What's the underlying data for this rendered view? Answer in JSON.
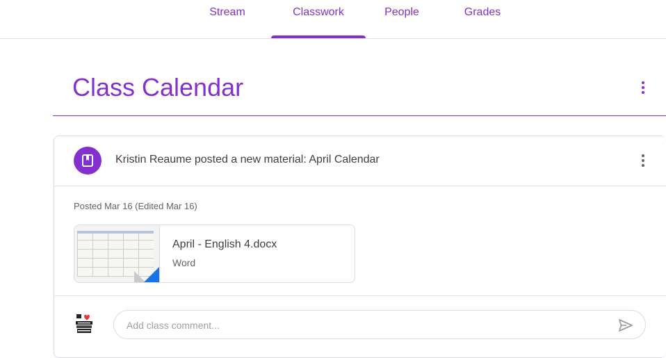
{
  "nav": {
    "tabs": [
      {
        "label": "Stream"
      },
      {
        "label": "Classwork"
      },
      {
        "label": "People"
      },
      {
        "label": "Grades"
      }
    ],
    "active": "Classwork"
  },
  "topic": {
    "title": "Class Calendar"
  },
  "post": {
    "title": "Kristin Reaume posted a new material: April Calendar",
    "posted": "Posted Mar 16 (Edited Mar 16)",
    "attachment": {
      "name": "April - English 4.docx",
      "type": "Word"
    },
    "comment": {
      "placeholder": "Add class comment..."
    }
  },
  "colors": {
    "accent": "#8430ce",
    "word_blue": "#1a73e8"
  },
  "icons": [
    "material-icon",
    "more-vert-icon",
    "send-icon",
    "avatar-image"
  ]
}
